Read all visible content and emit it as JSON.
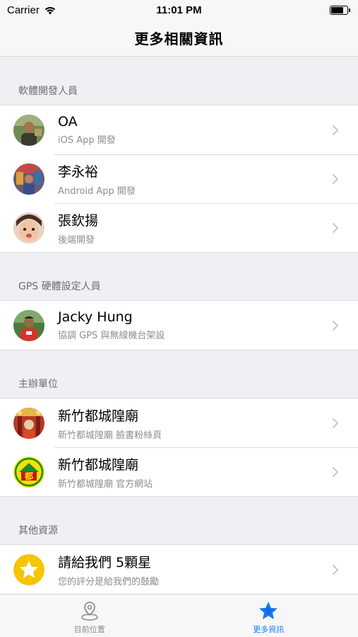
{
  "status_bar": {
    "carrier": "Carrier",
    "time": "11:01 PM"
  },
  "nav": {
    "title": "更多相關資訊"
  },
  "sections": [
    {
      "header": "軟體開發人員",
      "rows": [
        {
          "title": "OA",
          "subtitle": "iOS App 開發",
          "avatar": "photo-avatar-oa"
        },
        {
          "title": "李永裕",
          "subtitle": "Android App 開發",
          "avatar": "photo-avatar-li"
        },
        {
          "title": "張欽揚",
          "subtitle": "後端開發",
          "avatar": "photo-avatar-chang"
        }
      ]
    },
    {
      "header": "GPS 硬體設定人員",
      "rows": [
        {
          "title": "Jacky Hung",
          "subtitle": "協調 GPS 與無線機台架設",
          "avatar": "photo-avatar-jacky"
        }
      ]
    },
    {
      "header": "主辦單位",
      "rows": [
        {
          "title": "新竹都城隍廟",
          "subtitle": "新竹都城隍廟 臉書粉絲頁",
          "avatar": "temple-photo-avatar"
        },
        {
          "title": "新竹都城隍廟",
          "subtitle": "新竹都城隍廟 官方網站",
          "avatar": "temple-logo-avatar",
          "logo_char": "都"
        }
      ]
    },
    {
      "header": "其他資源",
      "rows": [
        {
          "title": "請給我們 5顆星",
          "subtitle": "您的評分是給我們的鼓勵",
          "avatar": "star-icon"
        }
      ]
    }
  ],
  "tabs": [
    {
      "label": "目前位置",
      "icon": "location-pin-icon",
      "active": false
    },
    {
      "label": "更多資訊",
      "icon": "star-icon",
      "active": true
    }
  ],
  "colors": {
    "accent": "#1a7cf5",
    "star_yellow": "#f6c400",
    "chevron": "#c7c7cc"
  }
}
